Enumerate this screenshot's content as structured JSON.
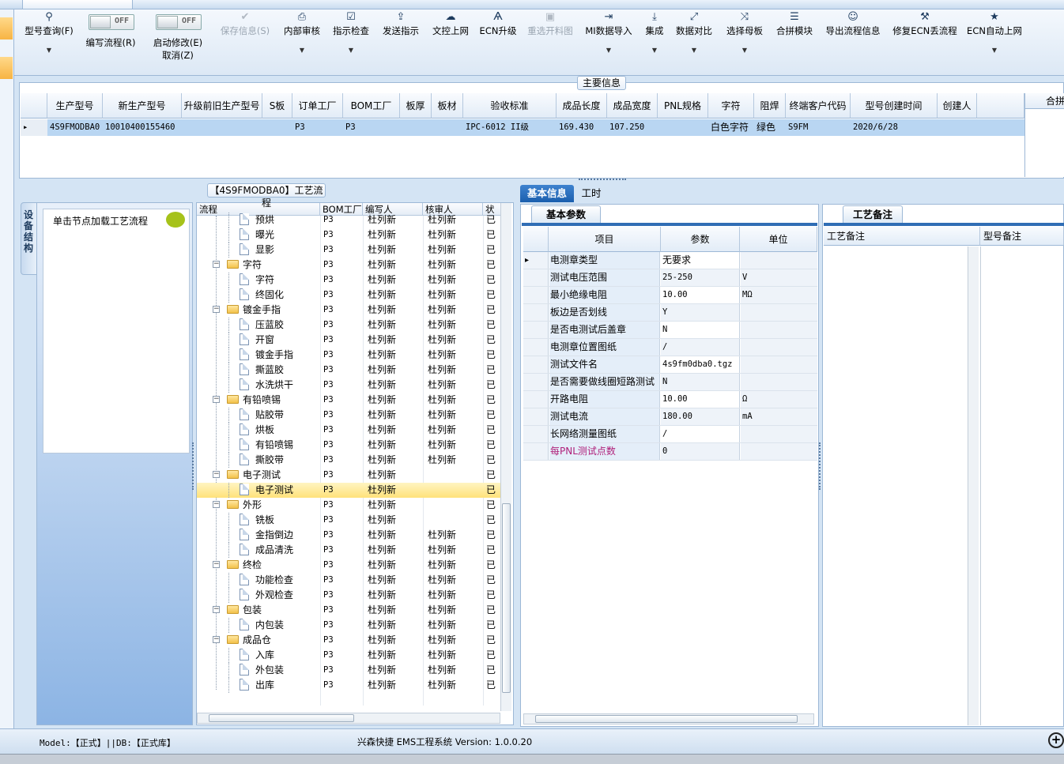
{
  "toolbar": {
    "items": [
      {
        "label": "型号查询(F)",
        "icon": "search-icon",
        "dropdown": true
      },
      {
        "label": "编写流程(R)",
        "toggle": "OFF"
      },
      {
        "label": "启动修改(E)",
        "sub": "取消(Z)",
        "toggle": "OFF"
      },
      {
        "label": "保存信息(S)",
        "icon": "check-icon",
        "disabled": true
      },
      {
        "label": "内部审核",
        "icon": "printer-icon",
        "dropdown": true
      },
      {
        "label": "指示检查",
        "icon": "checkbox-icon",
        "dropdown": true
      },
      {
        "label": "发送指示",
        "icon": "upload-icon"
      },
      {
        "label": "文控上网",
        "icon": "cloud-upload-icon"
      },
      {
        "label": "ECN升级",
        "icon": "ecn-icon"
      },
      {
        "label": "重选开料图",
        "icon": "image-icon",
        "disabled": true
      },
      {
        "label": "MI数据导入",
        "icon": "import-icon",
        "dropdown": true
      },
      {
        "label": "集成",
        "icon": "download-icon",
        "dropdown": true
      },
      {
        "label": "数据对比",
        "icon": "compare-icon",
        "dropdown": true
      },
      {
        "label": "选择母板",
        "icon": "shuffle-icon",
        "dropdown": true
      },
      {
        "label": "合拼模块",
        "icon": "list-icon"
      },
      {
        "label": "导出流程信息",
        "icon": "smile-icon"
      },
      {
        "label": "修复ECN丢流程",
        "icon": "wrench-icon"
      },
      {
        "label": "ECN自动上网",
        "icon": "star-icon",
        "dropdown": true
      }
    ]
  },
  "main_info": {
    "title": "主要信息",
    "columns": [
      "生产型号",
      "新生产型号",
      "升级前旧生产型号",
      "S板",
      "订单工厂",
      "BOM工厂",
      "板厚",
      "板材",
      "验收标准",
      "成品长度",
      "成品宽度",
      "PNL规格",
      "字符",
      "阻焊",
      "终端客户代码",
      "型号创建时间",
      "创建人"
    ],
    "row": [
      "4S9FMODBA0",
      "10010400155460",
      "",
      "",
      "P3",
      "P3",
      "",
      "",
      "IPC-6012 II级",
      "169.430",
      "107.250",
      "",
      "白色字符",
      "绿色",
      "S9FM",
      "2020/6/28",
      ""
    ],
    "right_header": "合拼"
  },
  "side": {
    "tab_label": "设备结构",
    "node_hint": "单击节点加载工艺流程"
  },
  "process": {
    "title": "【4S9FMODBA0】工艺流程",
    "columns": [
      "流程",
      "BOM工厂",
      "编写人",
      "核审人",
      "状"
    ],
    "rows": [
      {
        "level": 2,
        "name": "预烘",
        "bom": "P3",
        "writer": "杜列新",
        "reviewer": "杜列新",
        "status": "已"
      },
      {
        "level": 2,
        "name": "曝光",
        "bom": "P3",
        "writer": "杜列新",
        "reviewer": "杜列新",
        "status": "已"
      },
      {
        "level": 2,
        "name": "显影",
        "bom": "P3",
        "writer": "杜列新",
        "reviewer": "杜列新",
        "status": "已"
      },
      {
        "level": 1,
        "name": "字符",
        "bom": "P3",
        "writer": "杜列新",
        "reviewer": "杜列新",
        "status": "已"
      },
      {
        "level": 2,
        "name": "字符",
        "bom": "P3",
        "writer": "杜列新",
        "reviewer": "杜列新",
        "status": "已"
      },
      {
        "level": 2,
        "name": "终固化",
        "bom": "P3",
        "writer": "杜列新",
        "reviewer": "杜列新",
        "status": "已"
      },
      {
        "level": 1,
        "name": "镀金手指",
        "bom": "P3",
        "writer": "杜列新",
        "reviewer": "杜列新",
        "status": "已"
      },
      {
        "level": 2,
        "name": "压蓝胶",
        "bom": "P3",
        "writer": "杜列新",
        "reviewer": "杜列新",
        "status": "已"
      },
      {
        "level": 2,
        "name": "开窗",
        "bom": "P3",
        "writer": "杜列新",
        "reviewer": "杜列新",
        "status": "已"
      },
      {
        "level": 2,
        "name": "镀金手指",
        "bom": "P3",
        "writer": "杜列新",
        "reviewer": "杜列新",
        "status": "已"
      },
      {
        "level": 2,
        "name": "撕蓝胶",
        "bom": "P3",
        "writer": "杜列新",
        "reviewer": "杜列新",
        "status": "已"
      },
      {
        "level": 2,
        "name": "水洗烘干",
        "bom": "P3",
        "writer": "杜列新",
        "reviewer": "杜列新",
        "status": "已"
      },
      {
        "level": 1,
        "name": "有铅喷锡",
        "bom": "P3",
        "writer": "杜列新",
        "reviewer": "杜列新",
        "status": "已"
      },
      {
        "level": 2,
        "name": "贴胶带",
        "bom": "P3",
        "writer": "杜列新",
        "reviewer": "杜列新",
        "status": "已"
      },
      {
        "level": 2,
        "name": "烘板",
        "bom": "P3",
        "writer": "杜列新",
        "reviewer": "杜列新",
        "status": "已"
      },
      {
        "level": 2,
        "name": "有铅喷锡",
        "bom": "P3",
        "writer": "杜列新",
        "reviewer": "杜列新",
        "status": "已"
      },
      {
        "level": 2,
        "name": "撕胶带",
        "bom": "P3",
        "writer": "杜列新",
        "reviewer": "杜列新",
        "status": "已"
      },
      {
        "level": 1,
        "name": "电子测试",
        "bom": "P3",
        "writer": "杜列新",
        "reviewer": "",
        "status": "已"
      },
      {
        "level": 2,
        "name": "电子测试",
        "bom": "P3",
        "writer": "杜列新",
        "reviewer": "",
        "status": "已",
        "selected": true
      },
      {
        "level": 1,
        "name": "外形",
        "bom": "P3",
        "writer": "杜列新",
        "reviewer": "",
        "status": "已"
      },
      {
        "level": 2,
        "name": "铣板",
        "bom": "P3",
        "writer": "杜列新",
        "reviewer": "",
        "status": "已"
      },
      {
        "level": 2,
        "name": "金指倒边",
        "bom": "P3",
        "writer": "杜列新",
        "reviewer": "杜列新",
        "status": "已"
      },
      {
        "level": 2,
        "name": "成品清洗",
        "bom": "P3",
        "writer": "杜列新",
        "reviewer": "杜列新",
        "status": "已"
      },
      {
        "level": 1,
        "name": "终检",
        "bom": "P3",
        "writer": "杜列新",
        "reviewer": "杜列新",
        "status": "已"
      },
      {
        "level": 2,
        "name": "功能检查",
        "bom": "P3",
        "writer": "杜列新",
        "reviewer": "杜列新",
        "status": "已"
      },
      {
        "level": 2,
        "name": "外观检查",
        "bom": "P3",
        "writer": "杜列新",
        "reviewer": "杜列新",
        "status": "已"
      },
      {
        "level": 1,
        "name": "包装",
        "bom": "P3",
        "writer": "杜列新",
        "reviewer": "杜列新",
        "status": "已"
      },
      {
        "level": 2,
        "name": "内包装",
        "bom": "P3",
        "writer": "杜列新",
        "reviewer": "杜列新",
        "status": "已"
      },
      {
        "level": 1,
        "name": "成品仓",
        "bom": "P3",
        "writer": "杜列新",
        "reviewer": "杜列新",
        "status": "已"
      },
      {
        "level": 2,
        "name": "入库",
        "bom": "P3",
        "writer": "杜列新",
        "reviewer": "杜列新",
        "status": "已"
      },
      {
        "level": 2,
        "name": "外包装",
        "bom": "P3",
        "writer": "杜列新",
        "reviewer": "杜列新",
        "status": "已"
      },
      {
        "level": 2,
        "name": "出库",
        "bom": "P3",
        "writer": "杜列新",
        "reviewer": "杜列新",
        "status": "已"
      }
    ]
  },
  "info": {
    "tabs": [
      "基本信息",
      "工时"
    ],
    "params_tab": "基本参数",
    "columns": [
      "项目",
      "参数",
      "单位"
    ],
    "rows": [
      {
        "item": "电测章类型",
        "value": "无要求",
        "unit": ""
      },
      {
        "item": "测试电压范围",
        "value": "25-250",
        "unit": "V"
      },
      {
        "item": "最小绝缘电阻",
        "value": "10.00",
        "unit": "MΩ"
      },
      {
        "item": "板边是否划线",
        "value": "Y",
        "unit": ""
      },
      {
        "item": "是否电测试后盖章",
        "value": "N",
        "unit": ""
      },
      {
        "item": "电测章位置图纸",
        "value": "/",
        "unit": ""
      },
      {
        "item": "测试文件名",
        "value": "4s9fm0dba0.tgz",
        "unit": ""
      },
      {
        "item": "是否需要做线圈短路测试",
        "value": "N",
        "unit": ""
      },
      {
        "item": "开路电阻",
        "value": "10.00",
        "unit": "Ω"
      },
      {
        "item": "测试电流",
        "value": "180.00",
        "unit": "mA"
      },
      {
        "item": "长网络测量图纸",
        "value": "/",
        "unit": ""
      },
      {
        "item": "每PNL测试点数",
        "value": "0",
        "unit": "",
        "highlight": "#b0207a"
      }
    ],
    "remarks_tab": "工艺备注",
    "remark_columns": [
      "工艺备注",
      "型号备注"
    ]
  },
  "status": {
    "left": "Model:【正式】||DB:【正式库】",
    "center": "兴森快捷 EMS工程系统 Version: 1.0.0.20"
  }
}
